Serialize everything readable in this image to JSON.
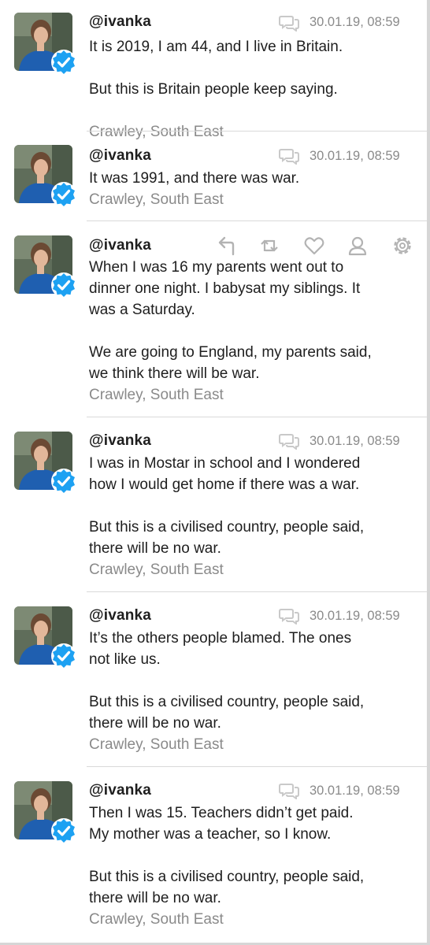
{
  "tweets": [
    {
      "handle": "@ivanka",
      "timestamp": "30.01.19, 08:59",
      "paragraphs": [
        "It is 2019, I am 44, and I live in Britain.",
        "But this is Britain people keep saying."
      ],
      "location": "Crawley, South East",
      "hovered": false
    },
    {
      "handle": "@ivanka",
      "timestamp": "30.01.19, 08:59",
      "paragraphs": [
        "It was 1991, and there was war."
      ],
      "location": "Crawley, South East",
      "hovered": false
    },
    {
      "handle": "@ivanka",
      "timestamp": "",
      "paragraphs": [
        "When I was 16 my parents went out to\ndinner one night. I babysat my siblings. It\nwas a Saturday.",
        "We are going to England, my parents said,\nwe think there will be war."
      ],
      "location": "Crawley, South East",
      "hovered": true,
      "actions": [
        "reply-icon",
        "retweet-icon",
        "like-icon",
        "profile-icon",
        "settings-gear-icon"
      ]
    },
    {
      "handle": "@ivanka",
      "timestamp": "30.01.19, 08:59",
      "paragraphs": [
        "I was in Mostar in school and I wondered\nhow I would get home if there was a war.",
        "But this is a civilised country, people said,\nthere will be no war."
      ],
      "location": "Crawley, South East",
      "hovered": false
    },
    {
      "handle": "@ivanka",
      "timestamp": "30.01.19, 08:59",
      "paragraphs": [
        "It’s the others people blamed. The ones\nnot like us.",
        "But this is a civilised country, people said,\nthere will be no war."
      ],
      "location": "Crawley, South East",
      "hovered": false
    },
    {
      "handle": "@ivanka",
      "timestamp": "30.01.19, 08:59",
      "paragraphs": [
        "Then I was 15. Teachers didn’t get paid.\nMy mother was a teacher, so I know.",
        "But this is a civilised country, people said,\nthere will be no war."
      ],
      "location": "Crawley, South East",
      "hovered": false
    }
  ],
  "colors": {
    "text": "#1e1e1e",
    "muted": "#8a8a8a",
    "verified": "#1da1f2",
    "divider": "#d9d9d9"
  }
}
